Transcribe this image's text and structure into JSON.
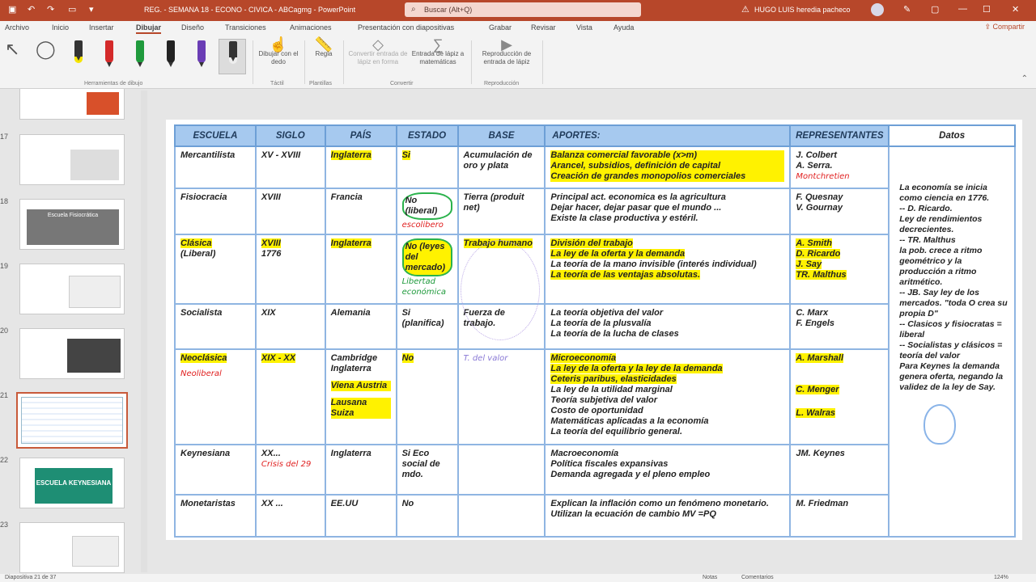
{
  "window": {
    "title": "REG. - SEMANA 18 - ECONO - CIVICA - ABCagmg  -  PowerPoint",
    "search_placeholder": "Buscar (Alt+Q)",
    "user": "HUGO LUIS heredia pacheco"
  },
  "menu": {
    "tabs": [
      "Archivo",
      "Inicio",
      "Insertar",
      "Dibujar",
      "Diseño",
      "Transiciones",
      "Animaciones",
      "Presentación con diapositivas",
      "Grabar",
      "Revisar",
      "Vista",
      "Ayuda"
    ],
    "active": "Dibujar",
    "share": "Compartir"
  },
  "ribbon": {
    "draw_finger": "Dibujar con el dedo",
    "ruler": "Regla",
    "convert_shape": "Convertir entrada de lápiz en forma",
    "ink_math": "Entrada de lápiz a matemáticas",
    "ink_replay": "Reproducción de entrada de lápiz",
    "groups": {
      "tools": "Herramientas de dibujo",
      "touch": "Táctil",
      "stencils": "Plantillas",
      "convert": "Convertir",
      "replay": "Reproducción"
    }
  },
  "slides_panel": {
    "numbers": [
      "17",
      "18",
      "19",
      "20",
      "21",
      "22",
      "23"
    ],
    "selected": "21",
    "thumb_titles": {
      "18": "Escuela Fisiocrática",
      "22": "ESCUELA KEYNESIANA"
    }
  },
  "table": {
    "headers": [
      "ESCUELA",
      "SIGLO",
      "PAÍS",
      "ESTADO",
      "BASE",
      "APORTES:",
      "REPRESENTANTES",
      "Datos"
    ],
    "rows": [
      {
        "escuela": "Mercantilista",
        "siglo": "XV - XVIII",
        "pais": "Inglaterra",
        "estado": "Si",
        "base": "Acumulación de oro y plata",
        "aportes": [
          "Balanza comercial favorable (x>m)",
          "Arancel, subsidios, definición de capital",
          "Creación de grandes monopolios comerciales"
        ],
        "representantes": [
          "J. Colbert",
          "A. Serra."
        ],
        "notes": "Montchretien"
      },
      {
        "escuela": "Fisiocracia",
        "siglo": "XVIII",
        "pais": "Francia",
        "estado": "No (liberal)",
        "base": "Tierra (produit net)",
        "aportes": [
          "Principal act. economica es la agricultura",
          "Dejar hacer, dejar pasar que el mundo ...",
          "Existe la clase productiva y estéril."
        ],
        "representantes": [
          "F. Quesnay",
          "V. Gournay"
        ],
        "notes": "escolibero"
      },
      {
        "escuela": "Clásica",
        "escuela2": "(Liberal)",
        "siglo": "XVIII",
        "siglo2": "1776",
        "pais": "Inglaterra",
        "estado": "No (leyes del mercado)",
        "base": "Trabajo humano",
        "aportes": [
          "División del trabajo",
          "La ley de la oferta y la demanda",
          "La teoría de la mano invisible (interés individual)",
          "La teoría de las ventajas absolutas."
        ],
        "representantes": [
          "A. Smith",
          "D. Ricardo",
          "J. Say",
          "TR. Malthus"
        ],
        "notes": "Libertad económica"
      },
      {
        "escuela": "Socialista",
        "siglo": "XIX",
        "pais": "Alemania",
        "estado": "Si (planifica)",
        "base": "Fuerza de trabajo.",
        "aportes": [
          "La teoría objetiva del valor",
          "La teoría de la plusvalía",
          "La teoría de la lucha de clases"
        ],
        "representantes": [
          "C. Marx",
          "F. Engels"
        ],
        "notes": "T. del valor"
      },
      {
        "escuela": "Neoclásica",
        "siglo": "XIX - XX",
        "pais": "Cambridge Inglaterra",
        "pais2": "Viena Austria",
        "pais3": "Lausana Suiza",
        "estado": "No",
        "base": "",
        "aportes": [
          "Microeconomía",
          "La ley de la oferta y la ley de la demanda",
          "Ceteris paribus, elasticidades",
          "La ley de la utilidad marginal",
          "Teoría subjetiva del valor",
          "Costo de oportunidad",
          "Matemáticas aplicadas a la economía",
          "La teoría del equilibrio general."
        ],
        "representantes": [
          "A. Marshall",
          "C. Menger",
          "L. Walras"
        ],
        "notes": "Neoliberal"
      },
      {
        "escuela": "Keynesiana",
        "siglo": "XX...",
        "pais": "Inglaterra",
        "estado": "Si Eco social de mdo.",
        "base": "",
        "aportes": [
          "Macroeconomía",
          "Política fiscales expansivas",
          "Demanda agregada y el pleno empleo"
        ],
        "representantes": [
          "JM. Keynes"
        ],
        "notes": "Crisis del 29"
      },
      {
        "escuela": "Monetaristas",
        "siglo": "XX ...",
        "pais": "EE.UU",
        "estado": "No",
        "base": "",
        "aportes": [
          "Explican la inflación como un fenómeno monetario.",
          "Utilizan la ecuación de cambio MV =PQ"
        ],
        "representantes": [
          "M. Friedman"
        ],
        "notes": ""
      }
    ],
    "datos_text": [
      "La economía se inicia como ciencia en 1776.",
      "-- D. Ricardo.",
      "Ley de rendimientos decrecientes.",
      "-- TR. Malthus",
      "la pob. crece a ritmo geométrico y la producción a ritmo aritmético.",
      "-- JB. Say ley de los mercados. \"toda O crea su propia D\"",
      "-- Clasicos y fisiocratas = liberal",
      "-- Socialistas y clásicos = teoría del valor",
      "Para Keynes la demanda genera oferta, negando la validez de la ley de Say."
    ]
  },
  "status": {
    "slide": "Diapositiva 21 de 37",
    "notes": "Notas",
    "comments": "Comentarios",
    "zoom": "124%"
  },
  "colors": {
    "accent": "#b7472a",
    "header_fill": "#a6c9ef",
    "highlight": "#fff200"
  }
}
